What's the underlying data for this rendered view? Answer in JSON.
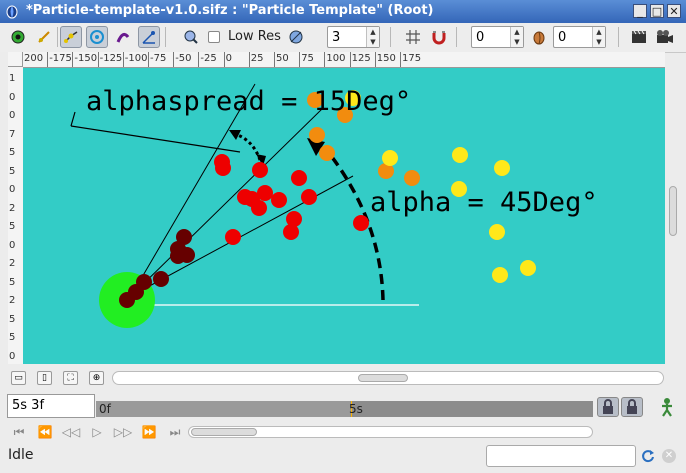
{
  "window": {
    "title": "*Particle-template-v1.0.sifz : \"Particle Template\" (Root)",
    "controls": [
      "minimize",
      "maximize",
      "close"
    ]
  },
  "toolbar": {
    "low_res_label": "Low Res",
    "low_res_checked": false,
    "spin_quality": "3",
    "spin_past_onion": "0",
    "spin_future_onion": "0"
  },
  "ruler": {
    "horizontal_ticks": [
      "200",
      "-175",
      "-150",
      "-125",
      "-100",
      "-75",
      "-50",
      "-25",
      "0",
      "25",
      "50",
      "75",
      "100",
      "125",
      "150",
      "175"
    ],
    "vertical_ticks": [
      "1",
      "0",
      "0",
      "7",
      "5",
      "5",
      "0",
      "2",
      "5",
      "0",
      "2",
      "5",
      "2",
      "5",
      "5",
      "0"
    ]
  },
  "canvas": {
    "background": "#33ccc6",
    "label_alphaspread": "alphaspread = 15Deg°",
    "label_alpha": "alpha = 45Deg°",
    "origin_color": "#22ee22",
    "particle_colors": {
      "dark": "#660000",
      "red": "#ee0000",
      "orange": "#f28c0e",
      "yellow": "#ffe81a"
    }
  },
  "timebar": {
    "current_time": "5s 3f",
    "start_label": "0f",
    "mid_label": "5s"
  },
  "status": {
    "text": "Idle",
    "progress": ""
  }
}
